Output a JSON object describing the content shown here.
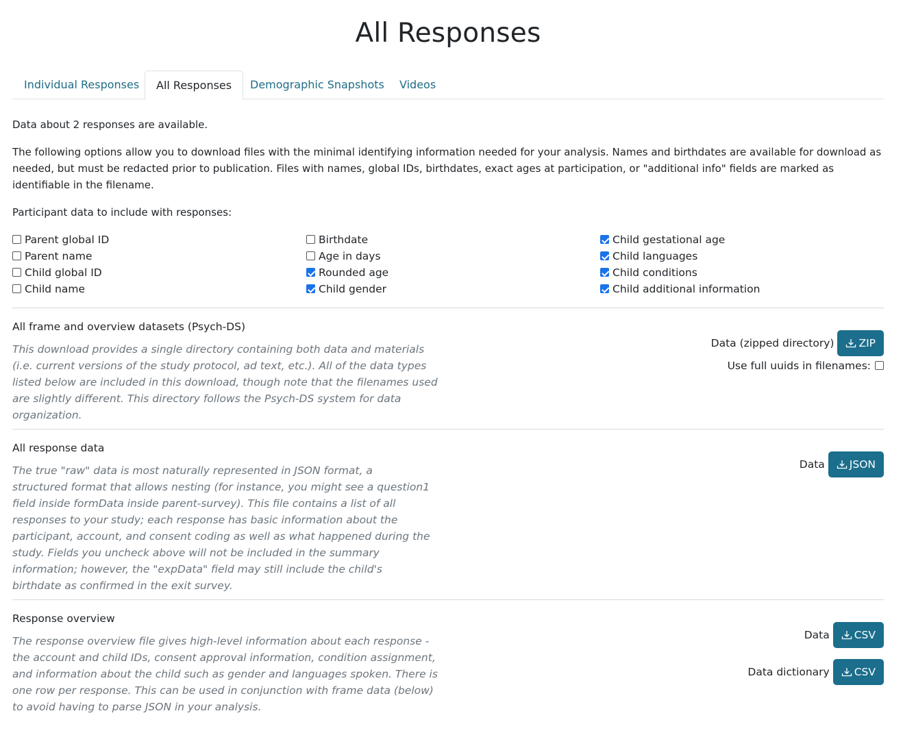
{
  "page_title": "All Responses",
  "tabs": [
    {
      "label": "Individual Responses",
      "active": false
    },
    {
      "label": "All Responses",
      "active": true
    },
    {
      "label": "Demographic Snapshots",
      "active": false
    },
    {
      "label": "Videos",
      "active": false
    }
  ],
  "intro": {
    "count_text": "Data about 2 responses are available.",
    "options_text": "The following options allow you to download files with the minimal identifying information needed for your analysis. Names and birthdates are available for download as needed, but must be redacted prior to publication. Files with names, global IDs, birthdates, exact ages at participation, or \"additional info\" fields are marked as identifiable in the filename.",
    "participant_data_label": "Participant data to include with responses:"
  },
  "checkboxes": [
    {
      "label": "Parent global ID",
      "checked": false
    },
    {
      "label": "Parent name",
      "checked": false
    },
    {
      "label": "Child global ID",
      "checked": false
    },
    {
      "label": "Child name",
      "checked": false
    },
    {
      "label": "Birthdate",
      "checked": false
    },
    {
      "label": "Age in days",
      "checked": false
    },
    {
      "label": "Rounded age",
      "checked": true
    },
    {
      "label": "Child gender",
      "checked": true
    },
    {
      "label": "Child gestational age",
      "checked": true
    },
    {
      "label": "Child languages",
      "checked": true
    },
    {
      "label": "Child conditions",
      "checked": true
    },
    {
      "label": "Child additional information",
      "checked": true
    }
  ],
  "sections": {
    "psychds": {
      "title": "All frame and overview datasets (Psych-DS)",
      "description": "This download provides a single directory containing both data and materials (i.e. current versions of the study protocol, ad text, etc.). All of the data types listed below are included in this download, though note that the filenames used are slightly different. This directory follows the Psych-DS system for data organization.",
      "download_label": "Data (zipped directory)",
      "button_label": "ZIP",
      "uuid_label": "Use full uuids in filenames:",
      "uuid_checked": false
    },
    "all_response": {
      "title": "All response data",
      "description": "The true \"raw\" data is most naturally represented in JSON format, a structured format that allows nesting (for instance, you might see a question1 field inside formData inside parent-survey). This file contains a list of all responses to your study; each response has basic information about the participant, account, and consent coding as well as what happened during the study. Fields you uncheck above will not be included in the summary information; however, the \"expData\" field may still include the child's birthdate as confirmed in the exit survey.",
      "download_label": "Data",
      "button_label": "JSON"
    },
    "overview": {
      "title": "Response overview",
      "description": "The response overview file gives high-level information about each response - the account and child IDs, consent approval information, condition assignment, and information about the child such as gender and languages spoken. There is one row per response. This can be used in conjunction with frame data (below) to avoid having to parse JSON in your analysis.",
      "download_label": "Data",
      "button_label": "CSV",
      "dictionary_label": "Data dictionary",
      "dictionary_button_label": "CSV"
    }
  },
  "colors": {
    "link": "#1f6c87",
    "button": "#1b6e8c",
    "checkbox_checked": "#1a73e8",
    "muted_text": "#6c757d"
  }
}
